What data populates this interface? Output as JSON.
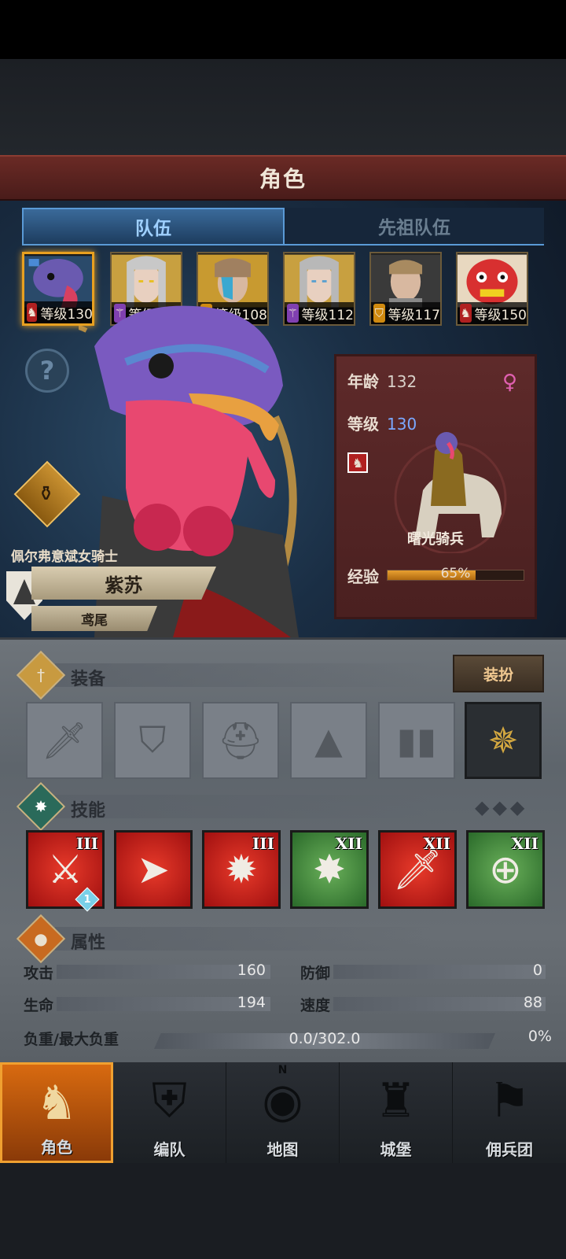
{
  "title": "角色",
  "tabs": [
    {
      "label": "队伍",
      "active": true
    },
    {
      "label": "先祖队伍",
      "active": false
    }
  ],
  "roster": [
    {
      "level_text": "等级130",
      "class_icon": "horse-icon",
      "class_color": "#b02020",
      "selected": true
    },
    {
      "level_text": "等级138",
      "class_icon": "staff-icon",
      "class_color": "#8040b0",
      "selected": false
    },
    {
      "level_text": "等级108",
      "class_icon": "shield-icon",
      "class_color": "#d08a10",
      "selected": false
    },
    {
      "level_text": "等级112",
      "class_icon": "staff-icon",
      "class_color": "#8040b0",
      "selected": false
    },
    {
      "level_text": "等级117",
      "class_icon": "shield-icon",
      "class_color": "#d08a10",
      "selected": false
    },
    {
      "level_text": "等级150",
      "class_icon": "horse-icon",
      "class_color": "#b02020",
      "selected": false
    }
  ],
  "hero": {
    "guild": "佩尔弗意斌女骑士",
    "name": "紫苏",
    "title": "鸢尾"
  },
  "info": {
    "age_label": "年龄",
    "age": "132",
    "level_label": "等级",
    "level": "130",
    "unit_name": "曙光骑兵",
    "exp_label": "经验",
    "exp_text": "65%",
    "exp_fraction": 0.65
  },
  "equipment": {
    "label": "装备",
    "dress_button": "装扮",
    "slots": [
      {
        "icon": "sword-icon",
        "equipped": false
      },
      {
        "icon": "shield-icon",
        "equipped": false
      },
      {
        "icon": "helmet-icon",
        "equipped": false
      },
      {
        "icon": "armor-icon",
        "equipped": false
      },
      {
        "icon": "boots-icon",
        "equipped": false
      },
      {
        "icon": "compass-amulet-icon",
        "equipped": true
      }
    ]
  },
  "skills": {
    "label": "技能",
    "items": [
      {
        "icon": "sword-boost-icon",
        "rank": "III",
        "color": "red",
        "badge": "1"
      },
      {
        "icon": "charge-icon",
        "rank": "",
        "color": "red",
        "badge": ""
      },
      {
        "icon": "strike-icon",
        "rank": "III",
        "color": "red",
        "badge": ""
      },
      {
        "icon": "burst-icon",
        "rank": "XII",
        "color": "green",
        "badge": ""
      },
      {
        "icon": "sword-icon",
        "rank": "XII",
        "color": "red",
        "badge": ""
      },
      {
        "icon": "target-icon",
        "rank": "XII",
        "color": "green",
        "badge": ""
      }
    ]
  },
  "attributes": {
    "label": "属性",
    "attack_label": "攻击",
    "attack": "160",
    "defense_label": "防御",
    "defense": "0",
    "hp_label": "生命",
    "hp": "194",
    "speed_label": "速度",
    "speed": "88",
    "load_label": "负重/最大负重",
    "load": "0.0/302.0",
    "load_pct": "0%"
  },
  "nav": [
    {
      "label": "角色",
      "icon": "knight-icon",
      "active": true
    },
    {
      "label": "编队",
      "icon": "formation-icon",
      "active": false
    },
    {
      "label": "地图",
      "icon": "map-compass-icon",
      "active": false
    },
    {
      "label": "城堡",
      "icon": "castle-icon",
      "active": false
    },
    {
      "label": "佣兵团",
      "icon": "mercenary-icon",
      "active": false
    }
  ],
  "compass_letter": "N"
}
